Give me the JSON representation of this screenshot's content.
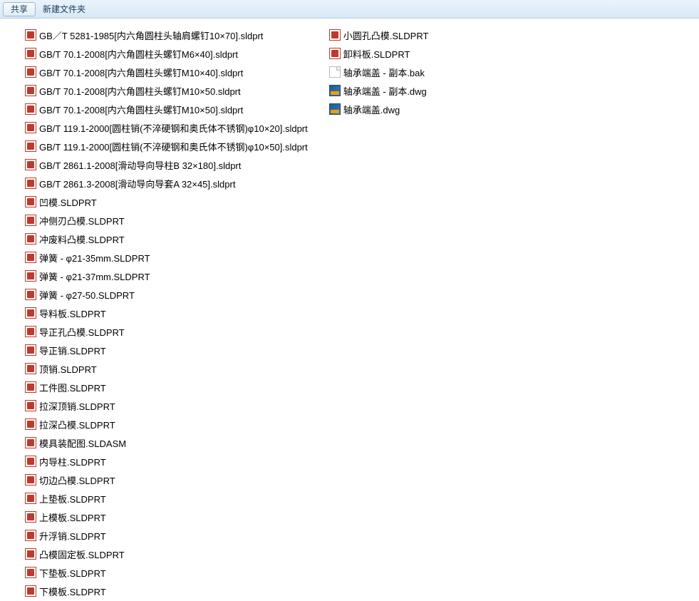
{
  "toolbar": {
    "share_label": "共享",
    "new_folder_label": "新建文件夹"
  },
  "files": {
    "column1": [
      {
        "name": "GB／T 5281-1985[内六角圆柱头轴肩螺钉10×70].sldprt",
        "type": "sldprt"
      },
      {
        "name": "GB/T 70.1-2008[内六角圆柱头螺钉M6×40].sldprt",
        "type": "sldprt"
      },
      {
        "name": "GB/T 70.1-2008[内六角圆柱头螺钉M10×40].sldprt",
        "type": "sldprt"
      },
      {
        "name": "GB/T 70.1-2008[内六角圆柱头螺钉M10×50.sldprt",
        "type": "sldprt"
      },
      {
        "name": "GB/T 70.1-2008[内六角圆柱头螺钉M10×50].sldprt",
        "type": "sldprt"
      },
      {
        "name": "GB/T 119.1-2000[圆柱销(不淬硬钢和奥氏体不锈钢)φ10×20].sldprt",
        "type": "sldprt"
      },
      {
        "name": "GB/T 119.1-2000[圆柱销(不淬硬钢和奥氏体不锈钢)φ10×50].sldprt",
        "type": "sldprt"
      },
      {
        "name": "GB/T 2861.1-2008[滑动导向导柱B 32×180].sldprt",
        "type": "sldprt"
      },
      {
        "name": "GB/T 2861.3-2008[滑动导向导套A 32×45].sldprt",
        "type": "sldprt"
      },
      {
        "name": "凹模.SLDPRT",
        "type": "sldprt"
      },
      {
        "name": "冲侧刃凸模.SLDPRT",
        "type": "sldprt"
      },
      {
        "name": "冲废料凸模.SLDPRT",
        "type": "sldprt"
      },
      {
        "name": "弹簧 - φ21-35mm.SLDPRT",
        "type": "sldprt"
      },
      {
        "name": "弹簧 - φ21-37mm.SLDPRT",
        "type": "sldprt"
      },
      {
        "name": "弹簧 - φ27-50.SLDPRT",
        "type": "sldprt"
      },
      {
        "name": "导料板.SLDPRT",
        "type": "sldprt"
      },
      {
        "name": "导正孔凸模.SLDPRT",
        "type": "sldprt"
      },
      {
        "name": "导正销.SLDPRT",
        "type": "sldprt"
      },
      {
        "name": "顶销.SLDPRT",
        "type": "sldprt"
      },
      {
        "name": "工件图.SLDPRT",
        "type": "sldprt"
      },
      {
        "name": "拉深顶销.SLDPRT",
        "type": "sldprt"
      },
      {
        "name": "拉深凸模.SLDPRT",
        "type": "sldprt"
      },
      {
        "name": "模具装配图.SLDASM",
        "type": "sldasm"
      },
      {
        "name": "内导柱.SLDPRT",
        "type": "sldprt"
      },
      {
        "name": "切边凸模.SLDPRT",
        "type": "sldprt"
      },
      {
        "name": "上垫板.SLDPRT",
        "type": "sldprt"
      },
      {
        "name": "上模板.SLDPRT",
        "type": "sldprt"
      },
      {
        "name": "升浮销.SLDPRT",
        "type": "sldprt"
      },
      {
        "name": "凸模固定板.SLDPRT",
        "type": "sldprt"
      },
      {
        "name": "下垫板.SLDPRT",
        "type": "sldprt"
      },
      {
        "name": "下模板.SLDPRT",
        "type": "sldprt"
      }
    ],
    "column2": [
      {
        "name": "小圆孔凸模.SLDPRT",
        "type": "sldprt"
      },
      {
        "name": "卸料板.SLDPRT",
        "type": "sldprt"
      },
      {
        "name": "轴承端盖 - 副本.bak",
        "type": "bak"
      },
      {
        "name": "轴承端盖 - 副本.dwg",
        "type": "dwg"
      },
      {
        "name": "轴承端盖.dwg",
        "type": "dwg"
      }
    ]
  }
}
